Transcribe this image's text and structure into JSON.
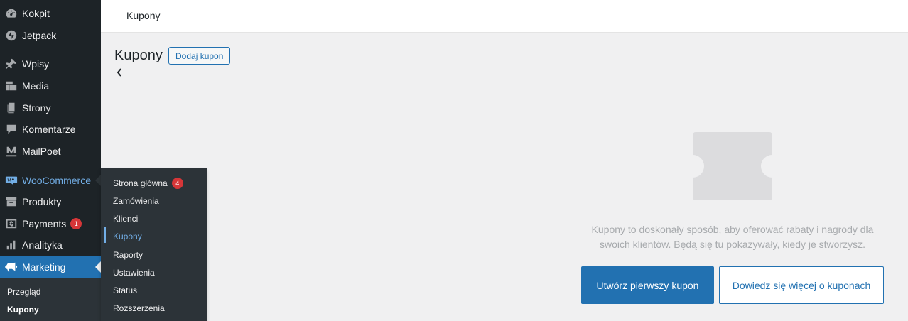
{
  "header": {
    "title": "Kupony"
  },
  "sidebar": {
    "items": [
      {
        "label": "Kokpit",
        "icon": "dashboard-icon"
      },
      {
        "label": "Jetpack",
        "icon": "jetpack-icon"
      },
      {
        "label": "Wpisy",
        "icon": "pin-icon"
      },
      {
        "label": "Media",
        "icon": "media-icon"
      },
      {
        "label": "Strony",
        "icon": "pages-icon"
      },
      {
        "label": "Komentarze",
        "icon": "comment-icon"
      },
      {
        "label": "MailPoet",
        "icon": "mailpoet-icon"
      },
      {
        "label": "WooCommerce",
        "icon": "woocommerce-icon"
      },
      {
        "label": "Produkty",
        "icon": "archive-icon"
      },
      {
        "label": "Payments",
        "icon": "dollar-icon",
        "badge": "1"
      },
      {
        "label": "Analityka",
        "icon": "bar-chart-icon"
      },
      {
        "label": "Marketing",
        "icon": "megaphone-icon"
      }
    ],
    "submenu": [
      {
        "label": "Przegląd"
      },
      {
        "label": "Kupony"
      }
    ]
  },
  "flyout": {
    "items": [
      {
        "label": "Strona główna",
        "badge": "4"
      },
      {
        "label": "Zamówienia"
      },
      {
        "label": "Klienci"
      },
      {
        "label": "Kupony"
      },
      {
        "label": "Raporty"
      },
      {
        "label": "Ustawienia"
      },
      {
        "label": "Status"
      },
      {
        "label": "Rozszerzenia"
      }
    ]
  },
  "page": {
    "title": "Kupony",
    "add_button": "Dodaj kupon"
  },
  "empty_state": {
    "text": "Kupony to doskonały sposób, aby oferować rabaty i nagrody dla swoich klientów. Będą się tu pokazywały, kiedy je stworzysz.",
    "primary_button": "Utwórz pierwszy kupon",
    "secondary_button": "Dowiedz się więcej o kuponach"
  },
  "colors": {
    "accent": "#2271b1",
    "sidebar_bg": "#1d2327",
    "badge": "#d63638",
    "woo_highlight": "#72aee6"
  }
}
